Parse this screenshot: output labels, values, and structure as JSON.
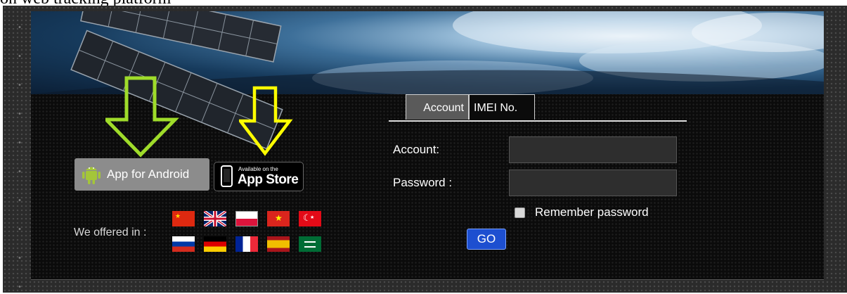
{
  "caption": {
    "text": "on web tracking platform"
  },
  "login": {
    "tabs": [
      {
        "label": "Account",
        "active": true
      },
      {
        "label": "IMEI No.",
        "active": false
      }
    ],
    "account_label": "Account:",
    "account_value": "",
    "password_label": "Password :",
    "password_value": "",
    "remember_label": "Remember password",
    "remember_checked": false,
    "go_label": "GO"
  },
  "apps": {
    "android_label": "App for Android",
    "appstore_small": "Available on the",
    "appstore_big": "App Store"
  },
  "languages": {
    "offered_label": "We offered in :",
    "flags": [
      "china-flag",
      "uk-flag",
      "poland-flag",
      "vietnam-flag",
      "turkey-flag",
      "russia-flag",
      "germany-flag",
      "france-flag",
      "spain-flag",
      "saudi-arabia-flag"
    ]
  },
  "colors": {
    "android_arrow": "#9fdc2a",
    "appstore_arrow": "#ffff00",
    "go_button": "#1d4fd0",
    "active_tab": "#5a5a5a"
  }
}
